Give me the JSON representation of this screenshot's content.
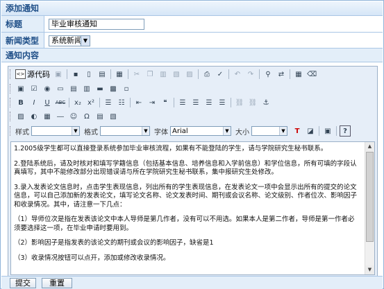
{
  "header": {
    "title": "添加通知"
  },
  "form": {
    "title_label": "标题",
    "title_value": "毕业审核通知",
    "type_label": "新闻类型",
    "type_value": "系统新闻",
    "content_label": "通知内容"
  },
  "toolbar": {
    "source_label": "源代码",
    "style_label": "样式",
    "format_label": "格式",
    "font_label": "字体",
    "font_value": "Arial",
    "size_label": "大小",
    "bold": "B",
    "italic": "I",
    "underline": "U",
    "strike": "ABC",
    "subscript": "x₂",
    "superscript": "x²",
    "text_color": "T",
    "help": "?"
  },
  "content": {
    "paragraphs": [
      "1.2005级学生都可以直接登录系统参加毕业审核流程，如果有不能登陆的学生，请与学院研究生秘书联系。",
      "2.登陆系统后，请及时核对和填写学籍信息（包括基本信息、培养信息和入学前信息）和学位信息，所有可填的字段认真填写，其中不能修改部分出现错误请与所在学院研究生秘书联系，集中报研究生处修改。",
      "3.录入发表论文信息时，点击学生表现信息，列出所有的学生表现信息，在发表论文一项中会显示出所有的提交的论文信息，可以自己添加新的发表论文，填写论文名称、论文发表时间、期刊或会议名称、论文级别、作者位次、影响因子和收录情况。其中，请注意一下几点：",
      "（1）导师位次是指在发表该论文中本人导师是第几作者，没有可以不用选。如果本人是第二作者，导师是第一作者必须要选择这一项，在毕业申请时要用到。",
      "（2）影响因子是指发表的该论文的期刊或会议的影响因子，缺省是1",
      "（3）收录情况按钮可以点开，添加或修改收录情况。"
    ]
  },
  "footer": {
    "submit_label": "提交",
    "reset_label": "重置"
  }
}
